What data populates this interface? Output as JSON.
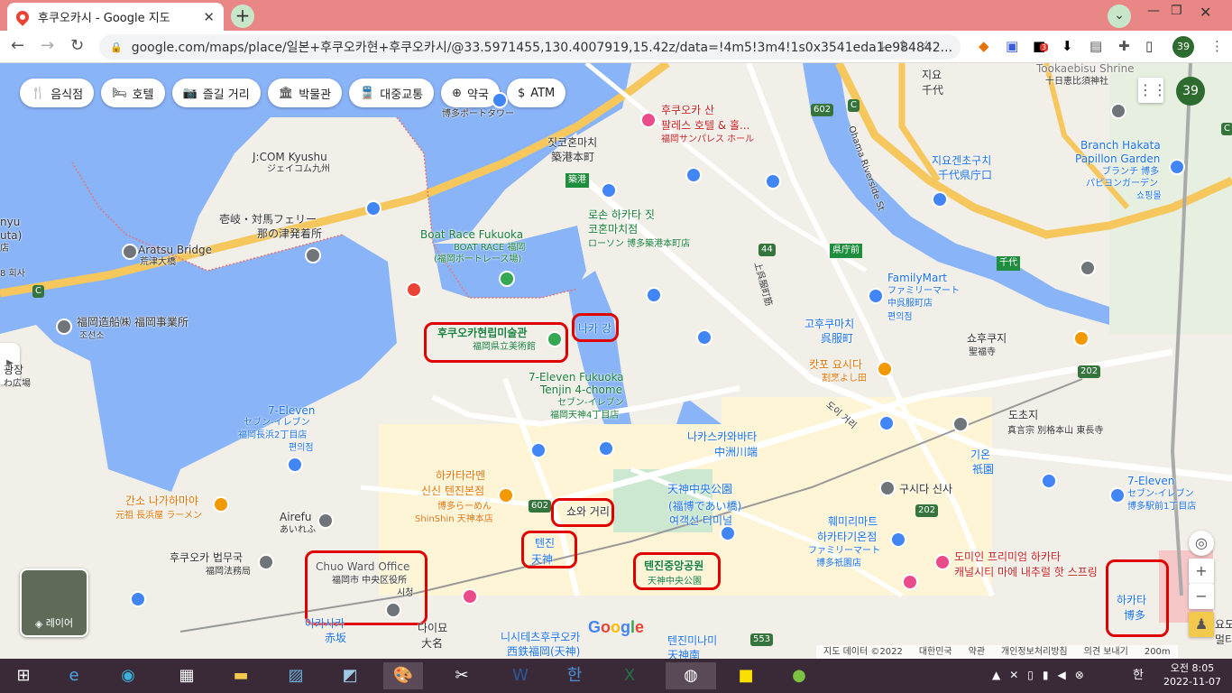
{
  "browser": {
    "tab_title": "후쿠오카시 - Google 지도",
    "url": "google.com/maps/place/일본+후쿠오카현+후쿠오카시/@33.5971455,130.4007919,15.42z/data=!4m5!3m4!1s0x3541eda1e984842...",
    "profile_badge": "39",
    "extension_badge": "3"
  },
  "map": {
    "chips": [
      {
        "icon": "restaurant-icon",
        "label": "음식점"
      },
      {
        "icon": "hotel-icon",
        "label": "호텔"
      },
      {
        "icon": "camera-icon",
        "label": "즐길 거리"
      },
      {
        "icon": "museum-icon",
        "label": "박물관"
      },
      {
        "icon": "transit-icon",
        "label": "대중교통"
      },
      {
        "icon": "pharmacy-icon",
        "label": "약국"
      },
      {
        "icon": "atm-icon",
        "label": "ATM"
      }
    ],
    "badge": "39",
    "layers_label": "레이어",
    "google_logo": "Google",
    "footer": {
      "data": "지도 데이터 ©2022",
      "country": "대한민국",
      "terms": "약관",
      "privacy": "개인정보처리방침",
      "feedback": "의견 보내기",
      "scale": "200m"
    },
    "labels": {
      "port_tower": "博多ポートタワー",
      "jcom": "J:COM Kyushu",
      "jcom_jp": "ジェイコム九州",
      "ferry": "壱岐・対馬フェリー",
      "ferry2": "那の津発着所",
      "aratsu": "Aratsu Bridge",
      "aratsu_jp": "荒津大橋",
      "shipbuilding": "福岡造船㈱ 福岡事業所",
      "choseon": "조선소",
      "boatrace": "Boat Race Fukuoka",
      "boatrace_jp": "BOAT RACE 福岡",
      "boatrace_jp2": "(福岡ボートレース場)",
      "museum": "후쿠오카현립미술관",
      "museum_jp": "福岡県立美術館",
      "naka_river": "나카 강",
      "seven_tenjin": "7-Eleven Fukuoka",
      "seven_tenjin2": "Tenjin 4-chome",
      "seven_tenjin3": "セブン-イレブン",
      "seven_tenjin4": "福岡天神4丁目店",
      "seven_nagahama": "7-Eleven",
      "seven_nagahama2": "セブン-イレブン",
      "seven_nagahama3": "福岡長浜2丁目店",
      "seven_nagahama4": "편의점",
      "chikko": "짓코혼마치",
      "chikko_jp": "築港本町",
      "chikko_stop": "築港",
      "lawson": "로손 하카타 짓",
      "lawson2": "코혼마치점",
      "lawson3": "ローソン 博多築港本町店",
      "sunpalace": "후쿠오카 산",
      "sunpalace2": "팔레스 호텔 & 홀...",
      "sunpalace3": "福岡サンパレス ホール",
      "chiyo": "지요",
      "chiyo2": "千代",
      "tookaebisu": "Tookaebisu Shrine",
      "tookaebisu2": "十日恵比須神社",
      "chiyokencho": "지요겐초구치",
      "chiyokencho2": "千代県庁口",
      "branch": "Branch Hakata",
      "branch2": "Papillon Garden",
      "branch3": "ブランチ 博多",
      "branch4": "パピヨンガーデン",
      "branch5": "쇼핑몰",
      "kenchomae": "県庁前",
      "familymart": "FamilyMart",
      "familymart2": "ファミリーマート",
      "familymart3": "中呉服町店",
      "familymart4": "편의점",
      "gofukumachi": "고후쿠마치",
      "gofukumachi2": "呉服町",
      "shofukuji": "쇼후쿠지",
      "shofukuji2": "聖福寺",
      "chiyo_road": "千代",
      "kappo": "캇포 요시다",
      "kappo2": "割烹よし田",
      "nakasu": "나카스카와바타",
      "nakasu2": "中洲川端",
      "tochoji": "도초지",
      "tochoji2": "真言宗 別格本山 東長寺",
      "gion": "기온",
      "gion2": "祇園",
      "kushida": "구시다 신사",
      "tenjin_park": "天神中央公園",
      "tenjin_park2": "(福博であい橋)",
      "tenjin_park3": "여객선 터미널",
      "familymart_gion": "훼미리마트",
      "familymart_gion2": "하카타기온점",
      "familymart_gion3": "ファミリーマート",
      "familymart_gion4": "博多祇園店",
      "dormy": "도미인 프리미엄 하카타",
      "dormy2": "캐널시티 마에 내추럴 핫 스프링",
      "seven_hakata": "7-Eleven",
      "seven_hakata2": "セブン-イレブン",
      "seven_hakata3": "博多駅前1丁目店",
      "hakata_st": "하카타",
      "hakata_st2": "博多",
      "ramen_shop": "하카타라멘",
      "ramen_shop2": "신신 텐진본점",
      "ramen_shop3": "博多らーめん",
      "ramen_shop4": "ShinShin 天神本店",
      "ganso": "간소 나가하마야",
      "ganso2": "元祖 長浜屋 ラーメン",
      "airefu": "Airefu",
      "airefu2": "あいれふ",
      "legal": "후쿠오카 법무국",
      "legal2": "福岡法務局",
      "chuo": "Chuo Ward Office",
      "chuo2": "福岡市 中央区役所",
      "chuo3": "시청",
      "showa": "쇼와 거리",
      "tenjin": "텐진",
      "tenjin2": "天神",
      "tenjin_central": "텐진중앙공원",
      "tenjin_central2": "天神中央公園",
      "akasaka": "아카사카",
      "akasaka2": "赤坂",
      "daimyo": "다이묘",
      "daimyo2": "大名",
      "nishitetsu": "니시테츠후쿠오카",
      "nishitetsu2": "西鉄福岡(天神)",
      "tenjin_minami": "텐진미나미",
      "tenjin_minami2": "天神南",
      "plaza": "광장",
      "plaza2": "わ広場",
      "nyu": "nyu",
      "nyu2": "uta)",
      "nyu3": "8 회사",
      "nyu4": "店",
      "yodo": "요도",
      "yodo2": "멀티",
      "doi": "도이 거리",
      "oharu": "Ohama Riverside St",
      "road602a": "602",
      "road602b": "602",
      "road44": "44",
      "road202a": "202",
      "road202b": "202",
      "road553": "553",
      "roadC1": "C",
      "roadC2": "C",
      "roadC3": "C",
      "kamimachi": "上呉服町筋",
      "hakata_stop": "博多"
    }
  },
  "taskbar": {
    "time": "오전 8:05",
    "date": "2022-11-07",
    "ime": "한"
  }
}
